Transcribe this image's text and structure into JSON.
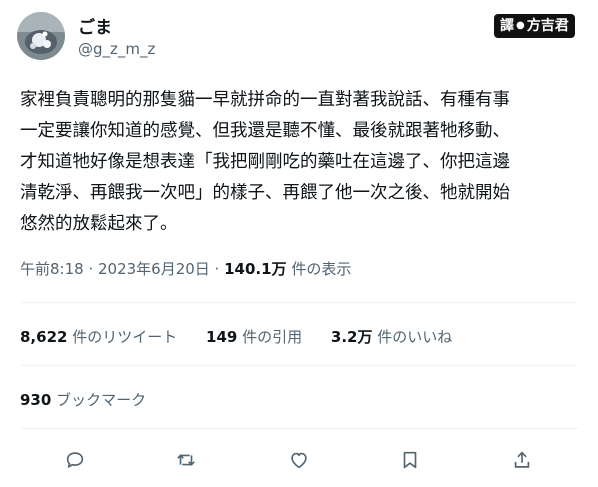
{
  "author": {
    "display_name": "ごま",
    "handle": "@g_z_m_z",
    "avatar_icon": "cat-photo-avatar"
  },
  "translator_badge": {
    "prefix": "譯",
    "name": "方吉君"
  },
  "tweet": {
    "lines": [
      "家裡負責聰明的那隻貓一早就拼命的一直對著我說話、有種有事",
      "一定要讓你知道的感覺、但我還是聽不懂、最後就跟著牠移動、",
      "才知道牠好像是想表達「我把剛剛吃的藥吐在這邊了、你把這邊",
      "清乾淨、再餵我一次吧」的樣子、再餵了他一次之後、牠就開始",
      "悠然的放鬆起來了。"
    ]
  },
  "meta": {
    "timestamp": "午前8:18 · 2023年6月20日 · ",
    "views": "140.1万",
    "views_label": " 件の表示"
  },
  "stats": {
    "retweets": "8,622",
    "retweets_label": " 件のリツイート",
    "quotes": "149",
    "quotes_label": " 件の引用",
    "likes": "3.2万",
    "likes_label": " 件のいいね"
  },
  "bookmarks": {
    "count": "930",
    "label": " ブックマーク"
  },
  "actions": {
    "reply_icon": "reply-icon",
    "retweet_icon": "retweet-icon",
    "like_icon": "heart-icon",
    "bookmark_icon": "bookmark-icon",
    "share_icon": "share-icon",
    "icon_color": "#536471"
  }
}
